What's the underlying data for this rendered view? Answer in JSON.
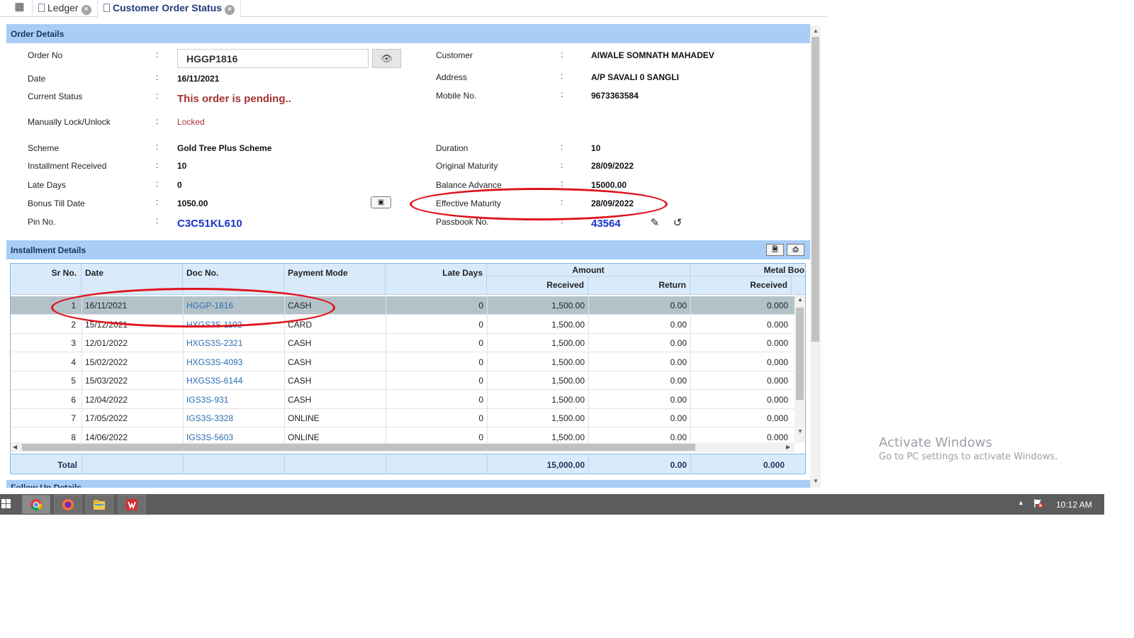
{
  "tabs": [
    {
      "label": "Ledger",
      "active": false
    },
    {
      "label": "Customer Order Status",
      "active": true
    }
  ],
  "order_details": {
    "header": "Order Details",
    "colon": ":",
    "order_no_label": "Order No",
    "order_no_value": "HGGP1816",
    "date_label": "Date",
    "date_value": "16/11/2021",
    "status_label": "Current Status",
    "status_value": "This order is pending..",
    "lock_label": "Manually Lock/Unlock",
    "lock_value": "Locked",
    "scheme_label": "Scheme",
    "scheme_value": "Gold Tree Plus Scheme",
    "inst_label": "Installment Received",
    "inst_value": "10",
    "late_label": "Late Days",
    "late_value": "0",
    "bonus_label": "Bonus Till Date",
    "bonus_value": "1050.00",
    "pin_label": "Pin No.",
    "pin_value": "C3C51KL610",
    "customer_label": "Customer",
    "customer_value": "AIWALE SOMNATH MAHADEV",
    "address_label": "Address",
    "address_value": "A/P SAVALI 0 SANGLI",
    "mobile_label": "Mobile No.",
    "mobile_value": "9673363584",
    "duration_label": "Duration",
    "duration_value": "10",
    "orig_label": "Original Maturity",
    "orig_value": "28/09/2022",
    "balance_label": "Balance Advance",
    "balance_value": "15000.00",
    "eff_label": "Effective Maturity",
    "eff_value": "28/09/2022",
    "passbook_label": "Passbook No.",
    "passbook_value": "43564"
  },
  "installments": {
    "header": "Installment Details",
    "columns": {
      "sr": "Sr No.",
      "date": "Date",
      "doc": "Doc No.",
      "mode": "Payment Mode",
      "late": "Late Days",
      "amount": "Amount",
      "received": "Received",
      "return": "Return",
      "metal": "Metal Boo",
      "metal_received": "Received"
    },
    "rows": [
      {
        "sr": "1",
        "date": "16/11/2021",
        "doc": "HGGP-1816",
        "mode": "CASH",
        "late": "0",
        "received": "1,500.00",
        "ret": "0.00",
        "metal": "0.000"
      },
      {
        "sr": "2",
        "date": "15/12/2021",
        "doc": "HXGS3S-1102",
        "mode": "CARD",
        "late": "0",
        "received": "1,500.00",
        "ret": "0.00",
        "metal": "0.000"
      },
      {
        "sr": "3",
        "date": "12/01/2022",
        "doc": "HXGS3S-2321",
        "mode": "CASH",
        "late": "0",
        "received": "1,500.00",
        "ret": "0.00",
        "metal": "0.000"
      },
      {
        "sr": "4",
        "date": "15/02/2022",
        "doc": "HXGS3S-4093",
        "mode": "CASH",
        "late": "0",
        "received": "1,500.00",
        "ret": "0.00",
        "metal": "0.000"
      },
      {
        "sr": "5",
        "date": "15/03/2022",
        "doc": "HXGS3S-6144",
        "mode": "CASH",
        "late": "0",
        "received": "1,500.00",
        "ret": "0.00",
        "metal": "0.000"
      },
      {
        "sr": "6",
        "date": "12/04/2022",
        "doc": "IGS3S-931",
        "mode": "CASH",
        "late": "0",
        "received": "1,500.00",
        "ret": "0.00",
        "metal": "0.000"
      },
      {
        "sr": "7",
        "date": "17/05/2022",
        "doc": "IGS3S-3328",
        "mode": "ONLINE",
        "late": "0",
        "received": "1,500.00",
        "ret": "0.00",
        "metal": "0.000"
      },
      {
        "sr": "8",
        "date": "14/06/2022",
        "doc": "IGS3S-5603",
        "mode": "ONLINE",
        "late": "0",
        "received": "1,500.00",
        "ret": "0.00",
        "metal": "0.000"
      }
    ],
    "total_label": "Total",
    "total_received": "15,000.00",
    "total_return": "0.00",
    "total_metal": "0.000"
  },
  "next_section_header": "Follow Up Details",
  "watermark": {
    "line1": "Activate Windows",
    "line2": "Go to PC settings to activate Windows."
  },
  "taskbar": {
    "clock": "10:12 AM",
    "apps": [
      "chrome-icon",
      "firefox-icon",
      "file-explorer-icon",
      "app-icon"
    ]
  },
  "colors": {
    "section_header": "#a8cdf7",
    "annotation": "#e0121b",
    "link": "#2a6db0",
    "pin": "#1a35c8",
    "status": "#a83232"
  }
}
